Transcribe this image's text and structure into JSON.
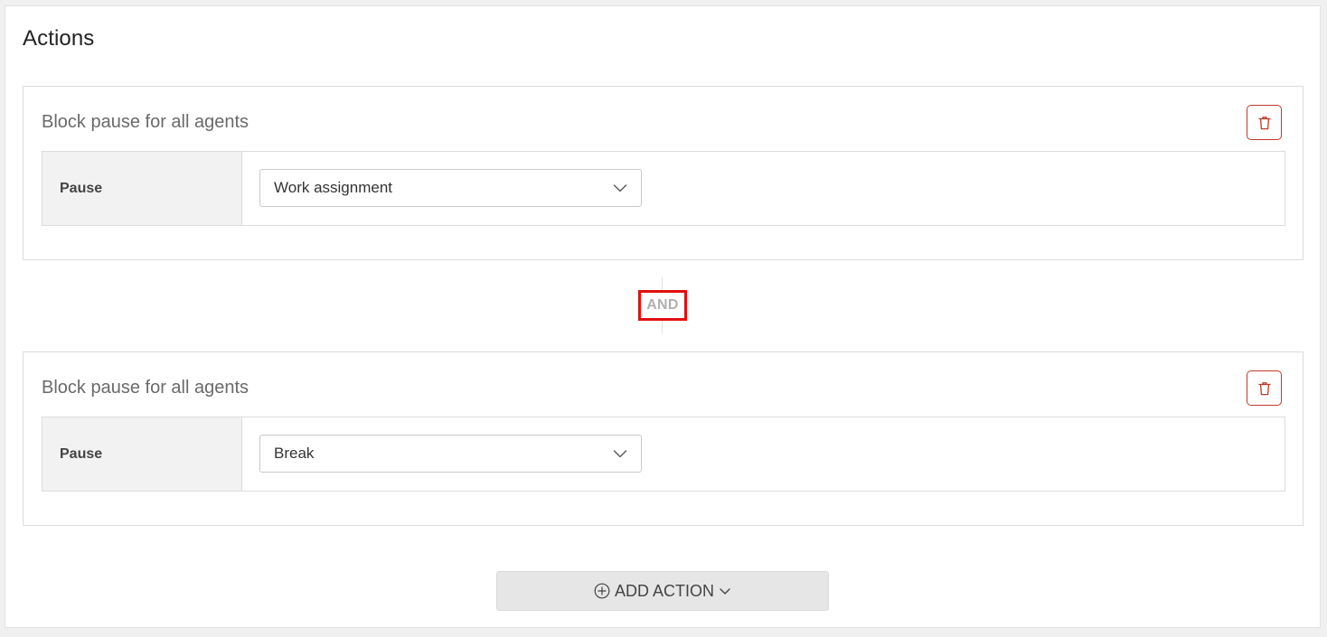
{
  "section": {
    "title": "Actions"
  },
  "actions": [
    {
      "title": "Block pause for all agents",
      "field_label": "Pause",
      "selected_value": "Work assignment"
    },
    {
      "title": "Block pause for all agents",
      "field_label": "Pause",
      "selected_value": "Break"
    }
  ],
  "connector": {
    "label": "AND"
  },
  "footer": {
    "add_action_label": "ADD ACTION"
  },
  "icons": {
    "delete": "trash-icon",
    "dropdown": "chevron-down-icon",
    "add": "plus-circle-icon"
  },
  "colors": {
    "delete_accent": "#c0392b",
    "and_highlight": "#e01010"
  }
}
